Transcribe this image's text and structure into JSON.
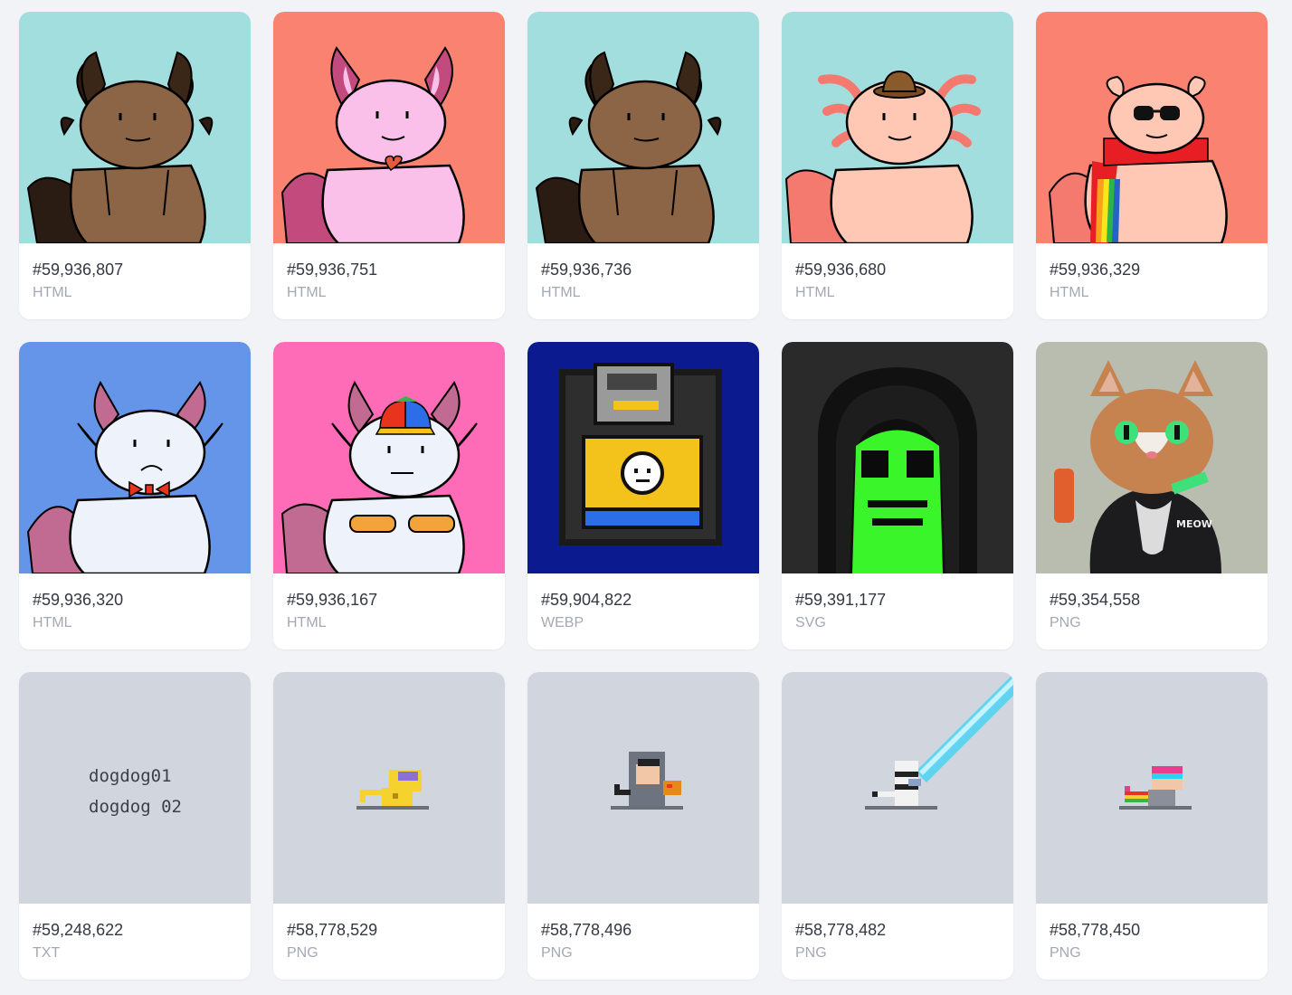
{
  "items": [
    {
      "number": "#59,936,807",
      "format": "HTML",
      "thumb": "axolotl-brown",
      "bg": "#a2dede"
    },
    {
      "number": "#59,936,751",
      "format": "HTML",
      "thumb": "axolotl-pink-heart",
      "bg": "#fa8270"
    },
    {
      "number": "#59,936,736",
      "format": "HTML",
      "thumb": "axolotl-brown",
      "bg": "#a2dede"
    },
    {
      "number": "#59,936,680",
      "format": "HTML",
      "thumb": "axolotl-peach-hat",
      "bg": "#a2dede"
    },
    {
      "number": "#59,936,329",
      "format": "HTML",
      "thumb": "axolotl-sunglasses-rainbow",
      "bg": "#fa8270"
    },
    {
      "number": "#59,936,320",
      "format": "HTML",
      "thumb": "axolotl-white-bowtie",
      "bg": "#6595e8"
    },
    {
      "number": "#59,936,167",
      "format": "HTML",
      "thumb": "axolotl-white-propeller-cap",
      "bg": "#fe6bb7"
    },
    {
      "number": "#59,904,822",
      "format": "WEBP",
      "thumb": "pixel-floppy-disk",
      "bg": "#0b1a8f"
    },
    {
      "number": "#59,391,177",
      "format": "SVG",
      "thumb": "pixel-green-hooded-face",
      "bg": "#2a2a2a"
    },
    {
      "number": "#59,354,558",
      "format": "PNG",
      "thumb": "cat-leather-jacket",
      "bg": "#b9bdb0"
    },
    {
      "number": "#59,248,622",
      "format": "TXT",
      "thumb": "text-preview",
      "bg": "#d1d6de",
      "text_lines": [
        "dogdog01",
        "dogdog 02"
      ]
    },
    {
      "number": "#58,778,529",
      "format": "PNG",
      "thumb": "pixel-yellow-monkey",
      "bg": "#d1d6de"
    },
    {
      "number": "#58,778,496",
      "format": "PNG",
      "thumb": "pixel-hooded-monkey",
      "bg": "#d1d6de"
    },
    {
      "number": "#58,778,482",
      "format": "PNG",
      "thumb": "pixel-lightsaber-monkey",
      "bg": "#d1d6de"
    },
    {
      "number": "#58,778,450",
      "format": "PNG",
      "thumb": "pixel-rainbow-monkey",
      "bg": "#d1d6de"
    }
  ],
  "colors": {
    "page_bg": "#f1f3f6",
    "card_bg": "#ffffff",
    "number_text": "#333842",
    "format_text": "#a3a9b3"
  }
}
